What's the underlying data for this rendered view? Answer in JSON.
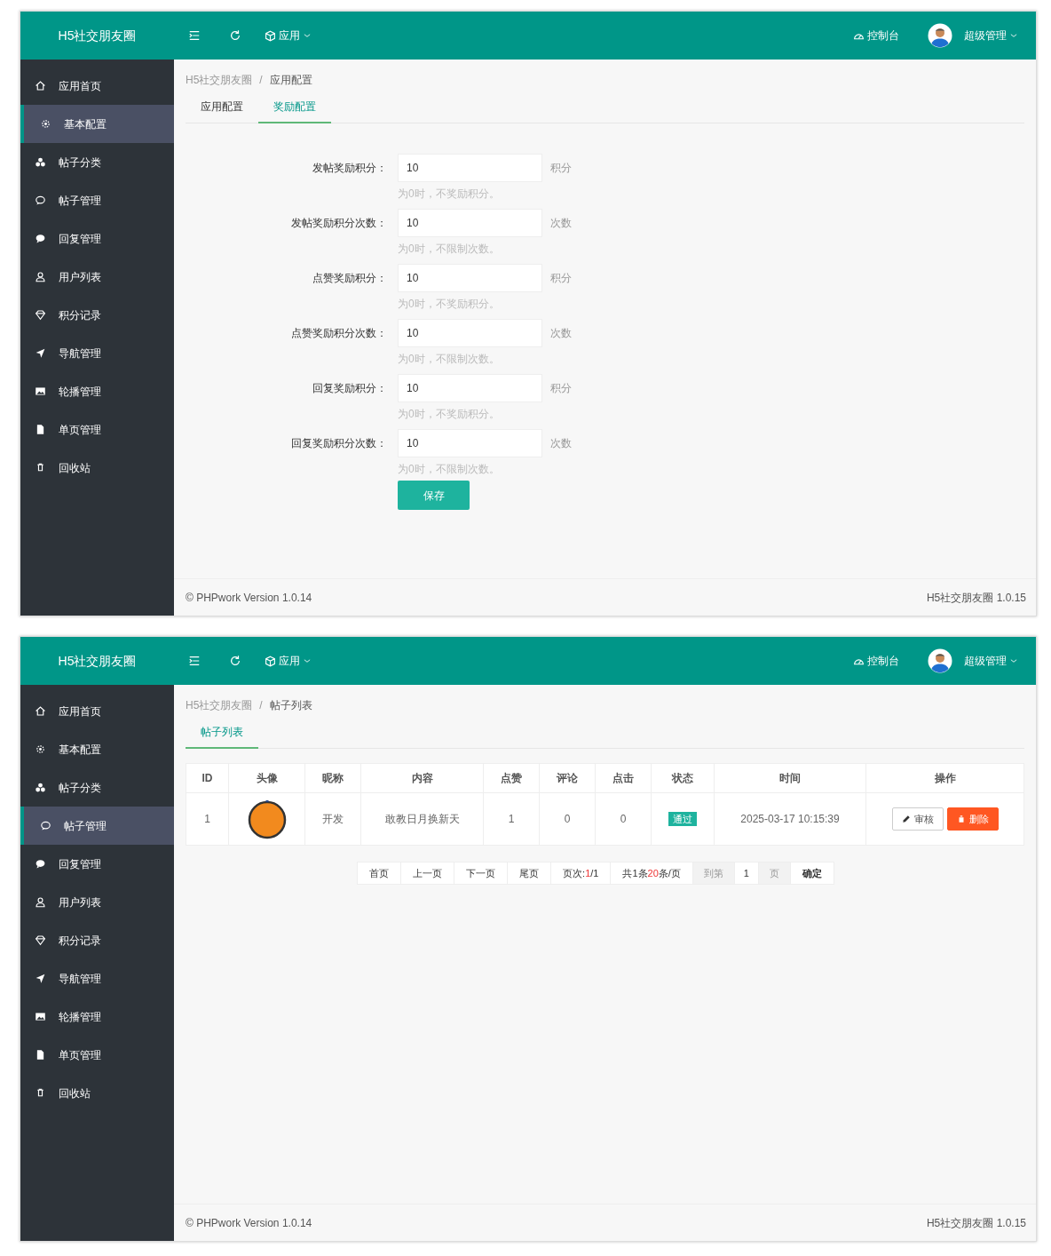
{
  "panels": [
    {
      "header": {
        "brand": "H5社交朋友圈",
        "menu": "应用",
        "console": "控制台",
        "user": "超级管理"
      },
      "sidebar": [
        {
          "label": "应用首页",
          "selected": false
        },
        {
          "label": "基本配置",
          "selected": true
        },
        {
          "label": "帖子分类",
          "selected": false
        },
        {
          "label": "帖子管理",
          "selected": false
        },
        {
          "label": "回复管理",
          "selected": false
        },
        {
          "label": "用户列表",
          "selected": false
        },
        {
          "label": "积分记录",
          "selected": false
        },
        {
          "label": "导航管理",
          "selected": false
        },
        {
          "label": "轮播管理",
          "selected": false
        },
        {
          "label": "单页管理",
          "selected": false
        },
        {
          "label": "回收站",
          "selected": false
        }
      ],
      "breadcrumb": [
        "H5社交朋友圈",
        "应用配置"
      ],
      "breadcrumb_separator": "/",
      "tabs": [
        {
          "label": "应用配置",
          "selected": false
        },
        {
          "label": "奖励配置",
          "selected": true
        }
      ],
      "content": {
        "kind": "form",
        "fields": [
          {
            "label": "发帖奖励积分：",
            "value": "10",
            "unit": "积分",
            "help": "为0时，不奖励积分。"
          },
          {
            "label": "发帖奖励积分次数：",
            "value": "10",
            "unit": "次数",
            "help": "为0时，不限制次数。"
          },
          {
            "label": "点赞奖励积分：",
            "value": "10",
            "unit": "积分",
            "help": "为0时，不奖励积分。"
          },
          {
            "label": "点赞奖励积分次数：",
            "value": "10",
            "unit": "次数",
            "help": "为0时，不限制次数。"
          },
          {
            "label": "回复奖励积分：",
            "value": "10",
            "unit": "积分",
            "help": "为0时，不奖励积分。"
          },
          {
            "label": "回复奖励积分次数：",
            "value": "10",
            "unit": "次数",
            "help": "为0时，不限制次数。"
          }
        ],
        "submit": "保存"
      },
      "footer": {
        "left": "© PHPwork Version 1.0.14",
        "right": "H5社交朋友圈 1.0.15"
      }
    },
    {
      "header": {
        "brand": "H5社交朋友圈",
        "menu": "应用",
        "console": "控制台",
        "user": "超级管理"
      },
      "sidebar": [
        {
          "label": "应用首页",
          "selected": false
        },
        {
          "label": "基本配置",
          "selected": false
        },
        {
          "label": "帖子分类",
          "selected": false
        },
        {
          "label": "帖子管理",
          "selected": true
        },
        {
          "label": "回复管理",
          "selected": false
        },
        {
          "label": "用户列表",
          "selected": false
        },
        {
          "label": "积分记录",
          "selected": false
        },
        {
          "label": "导航管理",
          "selected": false
        },
        {
          "label": "轮播管理",
          "selected": false
        },
        {
          "label": "单页管理",
          "selected": false
        },
        {
          "label": "回收站",
          "selected": false
        }
      ],
      "breadcrumb": [
        "H5社交朋友圈",
        "帖子列表"
      ],
      "breadcrumb_separator": "/",
      "tabs": [
        {
          "label": "帖子列表",
          "selected": true
        }
      ],
      "content": {
        "kind": "table",
        "columns": [
          "ID",
          "头像",
          "昵称",
          "内容",
          "点赞",
          "评论",
          "点击",
          "状态",
          "时间",
          "操作"
        ],
        "rows": [
          {
            "id": "1",
            "nickname": "开发",
            "content": "敢教日月换新天",
            "likes": "1",
            "comments": "0",
            "clicks": "0",
            "status": {
              "label": "通过",
              "kind": "pass"
            },
            "time": "2025-03-17 10:15:39",
            "actions": [
              {
                "label": "审核",
                "kind": "edit"
              },
              {
                "label": "删除",
                "kind": "delete"
              }
            ]
          }
        ],
        "pagination": [
          {
            "kind": "link",
            "label": "首页"
          },
          {
            "kind": "link",
            "label": "上一页"
          },
          {
            "kind": "link",
            "label": "下一页"
          },
          {
            "kind": "link",
            "label": "尾页"
          },
          {
            "kind": "info",
            "parts": [
              {
                "text": "页次:",
                "highlight": false
              },
              {
                "text": "1",
                "highlight": true
              },
              {
                "text": "/1",
                "highlight": false
              }
            ]
          },
          {
            "kind": "info",
            "parts": [
              {
                "text": "共1条 ",
                "highlight": false
              },
              {
                "text": "20",
                "highlight": true
              },
              {
                "text": "条/页",
                "highlight": false
              }
            ]
          },
          {
            "kind": "label",
            "label": "到第"
          },
          {
            "kind": "input",
            "value": "1"
          },
          {
            "kind": "label",
            "label": "页"
          },
          {
            "kind": "button",
            "label": "确定"
          }
        ]
      },
      "footer": {
        "left": "© PHPwork Version 1.0.14",
        "right": "H5社交朋友圈 1.0.15"
      }
    }
  ]
}
